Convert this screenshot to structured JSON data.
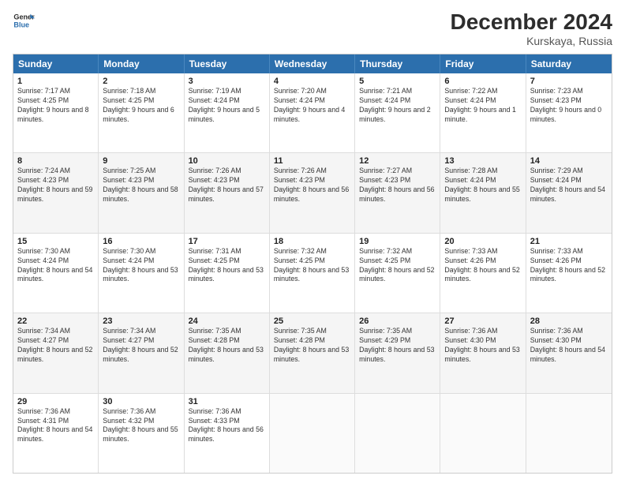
{
  "logo": {
    "line1": "General",
    "line2": "Blue"
  },
  "title": "December 2024",
  "subtitle": "Kurskaya, Russia",
  "header_days": [
    "Sunday",
    "Monday",
    "Tuesday",
    "Wednesday",
    "Thursday",
    "Friday",
    "Saturday"
  ],
  "weeks": [
    [
      {
        "day": "1",
        "sunrise": "7:17 AM",
        "sunset": "4:25 PM",
        "daylight": "9 hours and 8 minutes."
      },
      {
        "day": "2",
        "sunrise": "7:18 AM",
        "sunset": "4:25 PM",
        "daylight": "9 hours and 6 minutes."
      },
      {
        "day": "3",
        "sunrise": "7:19 AM",
        "sunset": "4:24 PM",
        "daylight": "9 hours and 5 minutes."
      },
      {
        "day": "4",
        "sunrise": "7:20 AM",
        "sunset": "4:24 PM",
        "daylight": "9 hours and 4 minutes."
      },
      {
        "day": "5",
        "sunrise": "7:21 AM",
        "sunset": "4:24 PM",
        "daylight": "9 hours and 2 minutes."
      },
      {
        "day": "6",
        "sunrise": "7:22 AM",
        "sunset": "4:24 PM",
        "daylight": "9 hours and 1 minute."
      },
      {
        "day": "7",
        "sunrise": "7:23 AM",
        "sunset": "4:23 PM",
        "daylight": "9 hours and 0 minutes."
      }
    ],
    [
      {
        "day": "8",
        "sunrise": "7:24 AM",
        "sunset": "4:23 PM",
        "daylight": "8 hours and 59 minutes."
      },
      {
        "day": "9",
        "sunrise": "7:25 AM",
        "sunset": "4:23 PM",
        "daylight": "8 hours and 58 minutes."
      },
      {
        "day": "10",
        "sunrise": "7:26 AM",
        "sunset": "4:23 PM",
        "daylight": "8 hours and 57 minutes."
      },
      {
        "day": "11",
        "sunrise": "7:26 AM",
        "sunset": "4:23 PM",
        "daylight": "8 hours and 56 minutes."
      },
      {
        "day": "12",
        "sunrise": "7:27 AM",
        "sunset": "4:23 PM",
        "daylight": "8 hours and 56 minutes."
      },
      {
        "day": "13",
        "sunrise": "7:28 AM",
        "sunset": "4:24 PM",
        "daylight": "8 hours and 55 minutes."
      },
      {
        "day": "14",
        "sunrise": "7:29 AM",
        "sunset": "4:24 PM",
        "daylight": "8 hours and 54 minutes."
      }
    ],
    [
      {
        "day": "15",
        "sunrise": "7:30 AM",
        "sunset": "4:24 PM",
        "daylight": "8 hours and 54 minutes."
      },
      {
        "day": "16",
        "sunrise": "7:30 AM",
        "sunset": "4:24 PM",
        "daylight": "8 hours and 53 minutes."
      },
      {
        "day": "17",
        "sunrise": "7:31 AM",
        "sunset": "4:25 PM",
        "daylight": "8 hours and 53 minutes."
      },
      {
        "day": "18",
        "sunrise": "7:32 AM",
        "sunset": "4:25 PM",
        "daylight": "8 hours and 53 minutes."
      },
      {
        "day": "19",
        "sunrise": "7:32 AM",
        "sunset": "4:25 PM",
        "daylight": "8 hours and 52 minutes."
      },
      {
        "day": "20",
        "sunrise": "7:33 AM",
        "sunset": "4:26 PM",
        "daylight": "8 hours and 52 minutes."
      },
      {
        "day": "21",
        "sunrise": "7:33 AM",
        "sunset": "4:26 PM",
        "daylight": "8 hours and 52 minutes."
      }
    ],
    [
      {
        "day": "22",
        "sunrise": "7:34 AM",
        "sunset": "4:27 PM",
        "daylight": "8 hours and 52 minutes."
      },
      {
        "day": "23",
        "sunrise": "7:34 AM",
        "sunset": "4:27 PM",
        "daylight": "8 hours and 52 minutes."
      },
      {
        "day": "24",
        "sunrise": "7:35 AM",
        "sunset": "4:28 PM",
        "daylight": "8 hours and 53 minutes."
      },
      {
        "day": "25",
        "sunrise": "7:35 AM",
        "sunset": "4:28 PM",
        "daylight": "8 hours and 53 minutes."
      },
      {
        "day": "26",
        "sunrise": "7:35 AM",
        "sunset": "4:29 PM",
        "daylight": "8 hours and 53 minutes."
      },
      {
        "day": "27",
        "sunrise": "7:36 AM",
        "sunset": "4:30 PM",
        "daylight": "8 hours and 53 minutes."
      },
      {
        "day": "28",
        "sunrise": "7:36 AM",
        "sunset": "4:30 PM",
        "daylight": "8 hours and 54 minutes."
      }
    ],
    [
      {
        "day": "29",
        "sunrise": "7:36 AM",
        "sunset": "4:31 PM",
        "daylight": "8 hours and 54 minutes."
      },
      {
        "day": "30",
        "sunrise": "7:36 AM",
        "sunset": "4:32 PM",
        "daylight": "8 hours and 55 minutes."
      },
      {
        "day": "31",
        "sunrise": "7:36 AM",
        "sunset": "4:33 PM",
        "daylight": "8 hours and 56 minutes."
      },
      null,
      null,
      null,
      null
    ]
  ],
  "labels": {
    "sunrise": "Sunrise:",
    "sunset": "Sunset:",
    "daylight": "Daylight:"
  }
}
